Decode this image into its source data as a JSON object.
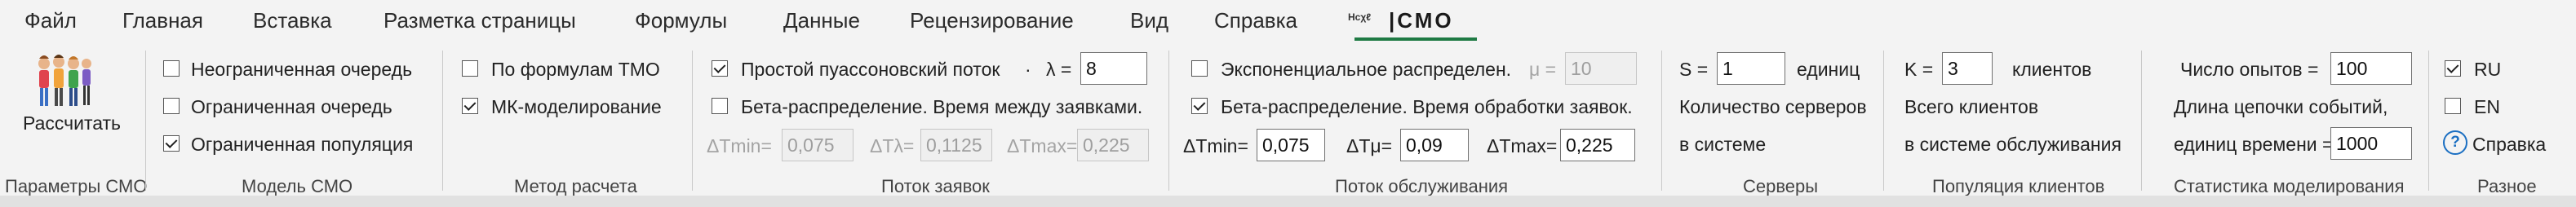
{
  "tabs": [
    {
      "label": "Файл"
    },
    {
      "label": "Главная"
    },
    {
      "label": "Вставка"
    },
    {
      "label": "Разметка страницы"
    },
    {
      "label": "Формулы"
    },
    {
      "label": "Данные"
    },
    {
      "label": "Рецензирование"
    },
    {
      "label": "Вид"
    },
    {
      "label": "Справка"
    },
    {
      "label": "СМО",
      "logo": "Hcχℓ",
      "active": true
    }
  ],
  "groups": {
    "params": {
      "label": "Параметры СМО",
      "run_button": "Рассчитать",
      "icon": "people-queue-icon"
    },
    "model": {
      "label": "Модель СМО",
      "options": [
        {
          "label": "Неограниченная очередь",
          "checked": false
        },
        {
          "label": "Ограниченная очередь",
          "checked": false
        },
        {
          "label": "Ограниченная популяция",
          "checked": true
        }
      ]
    },
    "method": {
      "label": "Метод расчета",
      "options": [
        {
          "label": "По формулам ТМО",
          "checked": false
        },
        {
          "label": "МК-моделирование",
          "checked": true
        }
      ]
    },
    "arrivals": {
      "label": "Поток заявок",
      "poisson": {
        "label": "Простой пуассоновский поток",
        "checked": true,
        "dot": "·",
        "lambda_label": "λ =",
        "lambda_value": "8"
      },
      "beta": {
        "label": "Бета-распределение. Время между заявками.",
        "checked": false
      },
      "tmin_label": "ΔTmin=",
      "tmin_value": "0,075",
      "tl_label": "ΔTλ=",
      "tl_value": "0,1125",
      "tmax_label": "ΔTmax=",
      "tmax_value": "0,225"
    },
    "service": {
      "label": "Поток обслуживания",
      "exp": {
        "label": "Экспоненциальное распределен.",
        "checked": false,
        "mu_label": "μ =",
        "mu_value": "10"
      },
      "beta": {
        "label": "Бета-распределение. Время обработки заявок.",
        "checked": true
      },
      "tmin_label": "ΔTmin=",
      "tmin_value": "0,075",
      "tmu_label": "ΔTμ=",
      "tmu_value": "0,09",
      "tmax_label": "ΔTmax=",
      "tmax_value": "0,225"
    },
    "servers": {
      "label": "Серверы",
      "s_label": "S =",
      "s_value": "1",
      "s_unit": "единиц",
      "desc1": "Количество серверов",
      "desc2": "в системе"
    },
    "population": {
      "label": "Популяция клиентов",
      "k_label": "K =",
      "k_value": "3",
      "k_unit": "клиентов",
      "desc1": "Всего клиентов",
      "desc2": "в системе обслуживания"
    },
    "stats": {
      "label": "Статистика моделирования",
      "runs_label": "Число опытов =",
      "runs_value": "100",
      "chain_label1": "Длина цепочки событий,",
      "chain_label2": "единиц времени =",
      "chain_value": "1000"
    },
    "misc": {
      "label": "Разное",
      "lang": [
        {
          "label": "RU",
          "checked": true
        },
        {
          "label": "EN",
          "checked": false
        }
      ],
      "help": "Справка"
    }
  },
  "colors": {
    "accent": "#1f7a44",
    "help": "#1b6fc2"
  }
}
